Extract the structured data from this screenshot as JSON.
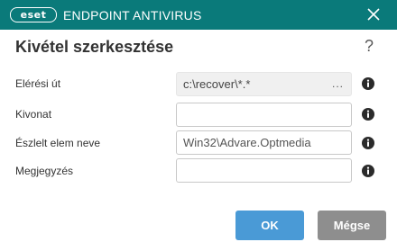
{
  "titlebar": {
    "logo_text": "eset",
    "product_name": "ENDPOINT ANTIVIRUS",
    "accent_color": "#0a7a7a"
  },
  "dialog": {
    "title": "Kivétel szerkesztése",
    "help_glyph": "?"
  },
  "form": {
    "path_label": "Elérési út",
    "path_value": "c:\\recover\\*.*",
    "browse_glyph": "...",
    "hash_label": "Kivonat",
    "hash_value": "",
    "detection_label": "Észlelt elem neve",
    "detection_value": "Win32\\Advare.Optmedia",
    "comment_label": "Megjegyzés",
    "comment_value": ""
  },
  "buttons": {
    "ok_label": "OK",
    "cancel_label": "Mégse",
    "ok_color": "#4a9ad6",
    "cancel_color": "#8e8e8e"
  },
  "icons": {
    "close": "close-icon",
    "help": "help-icon",
    "info": "info-icon"
  }
}
